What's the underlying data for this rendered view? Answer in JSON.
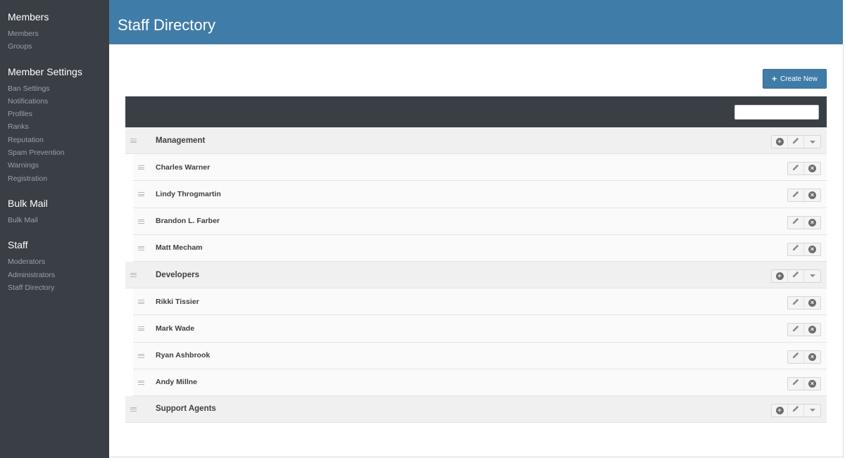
{
  "sidebar": {
    "sections": [
      {
        "title": "Members",
        "items": [
          "Members",
          "Groups"
        ]
      },
      {
        "title": "Member Settings",
        "items": [
          "Ban Settings",
          "Notifications",
          "Profiles",
          "Ranks",
          "Reputation",
          "Spam Prevention",
          "Warnings",
          "Registration"
        ]
      },
      {
        "title": "Bulk Mail",
        "items": [
          "Bulk Mail"
        ]
      },
      {
        "title": "Staff",
        "items": [
          "Moderators",
          "Administrators",
          "Staff Directory"
        ]
      }
    ]
  },
  "header": {
    "title": "Staff Directory"
  },
  "toolbar": {
    "create_label": "Create New",
    "create_icon": "plus-icon"
  },
  "search": {
    "placeholder": "",
    "value": ""
  },
  "groups": [
    {
      "name": "Management",
      "members": [
        "Charles Warner",
        "Lindy Throgmartin",
        "Brandon L. Farber",
        "Matt Mecham"
      ]
    },
    {
      "name": "Developers",
      "members": [
        "Rikki Tissier",
        "Mark Wade",
        "Ryan Ashbrook",
        "Andy Millne"
      ]
    },
    {
      "name": "Support Agents",
      "members": []
    }
  ],
  "colors": {
    "sidebar": "#3a3f46",
    "header": "#407ca8",
    "accent": "#407ca8"
  }
}
